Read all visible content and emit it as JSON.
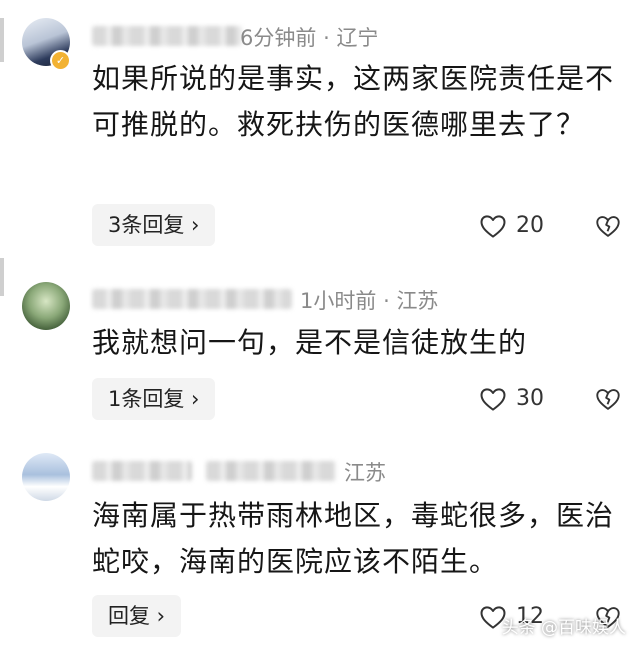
{
  "comments": [
    {
      "meta_time": "6分钟前",
      "meta_location": "辽宁",
      "text": "如果所说的是事实，这两家医院责任是不可推脱的。救死扶伤的医德哪里去了？",
      "reply_label": "3条回复 ›",
      "likes": "20"
    },
    {
      "meta_time": "1小时前",
      "meta_location": "江苏",
      "text": "我就想问一句，是不是信徒放生的",
      "reply_label": "1条回复 ›",
      "likes": "30"
    },
    {
      "meta_location": "江苏",
      "text": "海南属于热带雨林地区，毒蛇很多，医治蛇咬，海南的医院应该不陌生。",
      "reply_label": "回复 ›",
      "likes": "12"
    }
  ],
  "separator": "·",
  "watermark": "头条 @百味娱人",
  "icons": {
    "like": "heart-outline-icon",
    "dislike": "broken-heart-icon",
    "verified": "verified-badge-icon"
  }
}
